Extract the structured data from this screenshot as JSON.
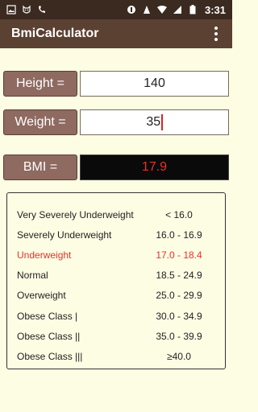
{
  "status_bar": {
    "time": "3:31",
    "left_icons": [
      "gallery-icon",
      "cat-face-icon",
      "phone-icon"
    ],
    "right_icons": [
      "notification-icon",
      "data-icon",
      "wifi-icon",
      "signal-icon",
      "battery-icon"
    ],
    "network_label": "LTE"
  },
  "app_bar": {
    "title": "BmiCalculator",
    "menu_icon": "overflow-menu-icon"
  },
  "inputs": {
    "height_label": "Height =",
    "height_value": "140",
    "weight_label": "Weight =",
    "weight_value": "35",
    "bmi_label": "BMI =",
    "bmi_value": "17.9"
  },
  "colors": {
    "highlight": "#e8322a",
    "label_bg": "#8e6a60",
    "appbar_bg": "#5b4132",
    "page_bg": "#fdfde4"
  },
  "bmi_table": {
    "highlighted_index": 2,
    "rows": [
      {
        "category": "Very Severely Underweight",
        "range": "< 16.0"
      },
      {
        "category": "Severely Underweight",
        "range": "16.0 - 16.9"
      },
      {
        "category": "Underweight",
        "range": "17.0 - 18.4"
      },
      {
        "category": "Normal",
        "range": "18.5 - 24.9"
      },
      {
        "category": "Overweight",
        "range": "25.0 - 29.9"
      },
      {
        "category": "Obese Class |",
        "range": "30.0 - 34.9"
      },
      {
        "category": "Obese Class ||",
        "range": "35.0 - 39.9"
      },
      {
        "category": "Obese Class |||",
        "range": "≥40.0"
      }
    ]
  }
}
